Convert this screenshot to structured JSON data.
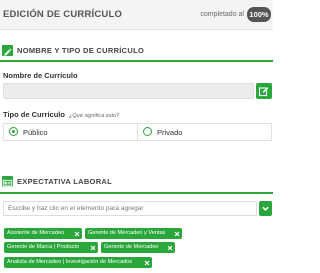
{
  "header": {
    "title": "EDICIÓN DE CURRÍCULO",
    "completion_label": "completado al",
    "completion_value": "100%"
  },
  "section_profile": {
    "title": "NOMBRE Y TIPO DE CURRÍCULO",
    "icon": "pencil-icon",
    "name_label": "Nombre de Currículo",
    "name_value": "",
    "type_label": "Tipo de Currículo",
    "type_help": "¿Qué significa esto?",
    "type_options": [
      {
        "label": "Público",
        "selected": true
      },
      {
        "label": "Privado",
        "selected": false
      }
    ]
  },
  "section_expectations": {
    "title": "EXPECTATIVA LABORAL",
    "icon": "id-card-icon",
    "search_placeholder": "Escribe y haz clic en el elemento para agregar",
    "tags": [
      "Asistente de Mercadeo",
      "Gerente de Mercadeo y Ventas",
      "Gerente de Marca | Producto",
      "Gerente de Mercadeo",
      "Analista de Mercadeo | Investigación de Mercados"
    ]
  },
  "colors": {
    "accent": "#2aa73a",
    "badge": "#555555",
    "header_bg": "#f4f4f4"
  }
}
